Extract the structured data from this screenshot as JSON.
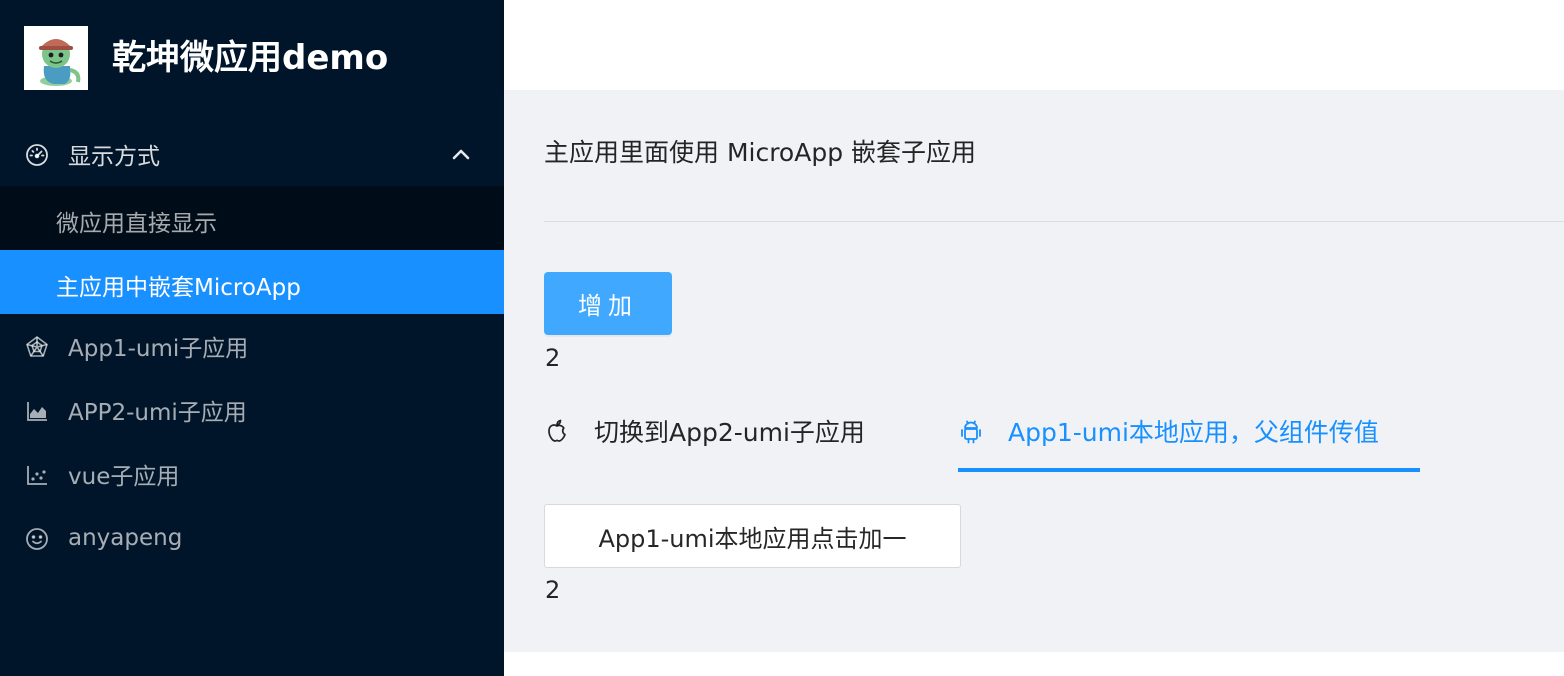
{
  "sidebar": {
    "logo_icon": "dinosaur-avatar-logo",
    "title": "乾坤微应用demo",
    "group": {
      "icon": "dashboard-icon",
      "label": "显示方式",
      "expanded": true,
      "children": [
        {
          "label": "微应用直接显示",
          "active": false
        },
        {
          "label": "主应用中嵌套MicroApp",
          "active": true
        }
      ]
    },
    "items": [
      {
        "icon": "radar-chart-icon",
        "label": "App1-umi子应用"
      },
      {
        "icon": "area-chart-icon",
        "label": "APP2-umi子应用"
      },
      {
        "icon": "dot-chart-icon",
        "label": "vue子应用"
      },
      {
        "icon": "smile-icon",
        "label": "anyapeng"
      }
    ]
  },
  "main": {
    "title": "主应用里面使用 MicroApp 嵌套子应用",
    "add_button": "增加",
    "count_top": "2",
    "tabs": [
      {
        "icon": "apple-icon",
        "label": "切换到App2-umi子应用",
        "active": false
      },
      {
        "icon": "android-icon",
        "label": "App1-umi本地应用，父组件传值",
        "active": true
      }
    ],
    "local_button": "App1-umi本地应用点击加一",
    "count_bottom": "2"
  },
  "colors": {
    "sidebar_bg": "#001529",
    "submenu_bg": "#000c17",
    "primary": "#1890ff",
    "primary_button": "#40a9ff",
    "content_bg": "#f0f2f5"
  }
}
